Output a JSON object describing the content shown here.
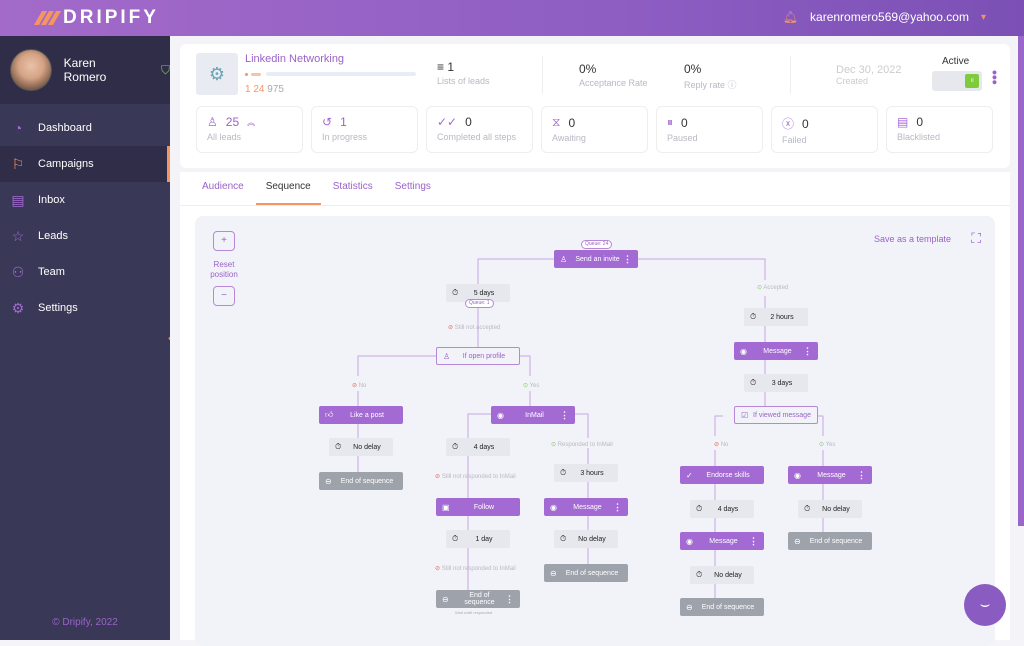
{
  "brand": {
    "name": "DRIPIFY"
  },
  "header": {
    "email": "karenromero569@yahoo.com"
  },
  "sidebar": {
    "user": {
      "name": "Karen Romero"
    },
    "items": [
      {
        "label": "Dashboard",
        "icon": "pie-chart-icon"
      },
      {
        "label": "Campaigns",
        "icon": "flag-icon",
        "active": true
      },
      {
        "label": "Inbox",
        "icon": "message-icon"
      },
      {
        "label": "Leads",
        "icon": "star-icon"
      },
      {
        "label": "Team",
        "icon": "team-icon"
      },
      {
        "label": "Settings",
        "icon": "gear-icon"
      }
    ],
    "copyright": "© Dripify, 2022"
  },
  "campaign": {
    "name": "Linkedin Networking",
    "progress": {
      "a": "1",
      "b": "24",
      "c": "975"
    },
    "lists": {
      "value": "1",
      "label": "Lists of leads"
    },
    "acceptance": {
      "value": "0%",
      "label": "Acceptance Rate"
    },
    "reply": {
      "value": "0%",
      "label": "Reply rate"
    },
    "created": {
      "value": "Dec 30, 2022",
      "label": "Created"
    },
    "status": {
      "label": "Active",
      "on": true
    }
  },
  "tiles": [
    {
      "value": "25",
      "label": "All leads",
      "icon": "user-icon"
    },
    {
      "value": "1",
      "label": "In progress",
      "icon": "progress-icon"
    },
    {
      "value": "0",
      "label": "Completed all steps",
      "icon": "double-check-icon"
    },
    {
      "value": "0",
      "label": "Awaiting",
      "icon": "hourglass-icon"
    },
    {
      "value": "0",
      "label": "Paused",
      "icon": "pause-icon"
    },
    {
      "value": "0",
      "label": "Failed",
      "icon": "failed-icon"
    },
    {
      "value": "0",
      "label": "Blacklisted",
      "icon": "blacklist-icon"
    }
  ],
  "tabs": [
    {
      "label": "Audience"
    },
    {
      "label": "Sequence",
      "active": true
    },
    {
      "label": "Statistics"
    },
    {
      "label": "Settings"
    }
  ],
  "canvas": {
    "zoom_in": "+",
    "zoom_out": "−",
    "reset": "Reset position",
    "save_template": "Save as a template"
  },
  "sequence": {
    "send_invite": {
      "label": "Send an invite",
      "queue": "Queue: 24"
    },
    "delay_5d": {
      "label": "5 days",
      "queue": "Queue: 1"
    },
    "still_not_accepted": "Still not accepted",
    "accepted": "Accepted",
    "if_open_profile": "If open profile",
    "no": "No",
    "yes": "Yes",
    "like_post": "Like a post",
    "no_delay": "No delay",
    "end": "End of sequence",
    "inmail": "InMail",
    "delay_4d": "4 days",
    "responded_inmail": "Responded to InMail",
    "not_responded_inmail": "Still not responded to InMail",
    "delay_3h": "3 hours",
    "follow": "Follow",
    "message": "Message",
    "delay_1d": "1 day",
    "wait_until": "Wait untill responded",
    "delay_2h": "2 hours",
    "delay_3d": "3 days",
    "if_viewed": "If viewed message",
    "endorse": "Endorse skills"
  }
}
